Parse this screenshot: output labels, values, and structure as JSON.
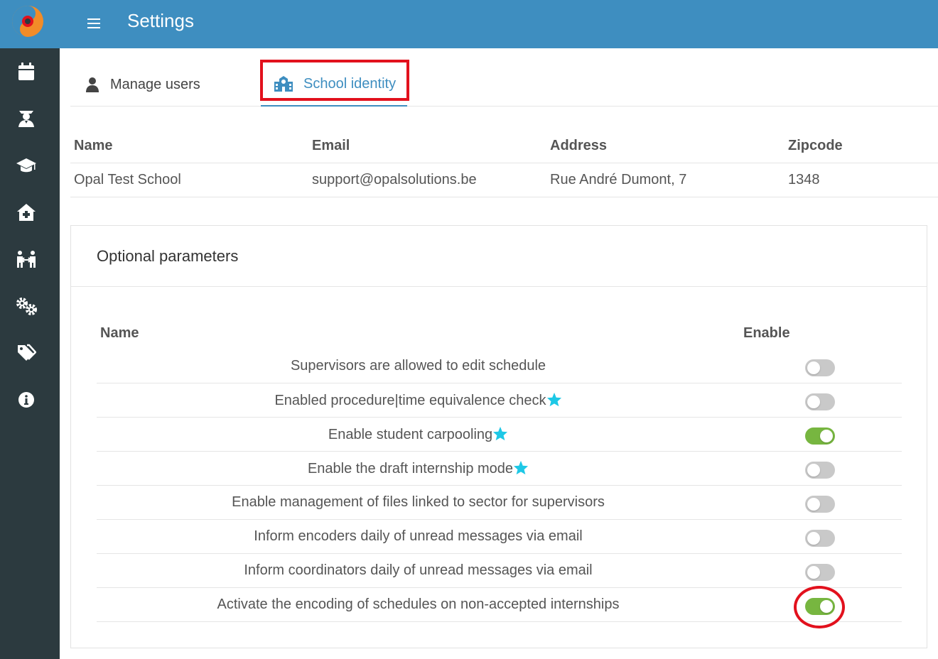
{
  "header": {
    "title": "Settings"
  },
  "sidebar": {
    "items": [
      {
        "icon": "calendar-icon"
      },
      {
        "icon": "graduate-user-icon"
      },
      {
        "icon": "graduation-cap-icon"
      },
      {
        "icon": "clinic-medical-icon"
      },
      {
        "icon": "people-arrows-icon"
      },
      {
        "icon": "cogs-icon"
      },
      {
        "icon": "tags-icon"
      },
      {
        "icon": "info-circle-icon"
      }
    ]
  },
  "tabs": {
    "manage_users": "Manage users",
    "school_identity": "School identity"
  },
  "identity_table": {
    "headers": [
      "Name",
      "Email",
      "Address",
      "Zipcode"
    ],
    "row": [
      "Opal Test School",
      "support@opalsolutions.be",
      "Rue André Dumont, 7",
      "1348"
    ]
  },
  "optional_parameters": {
    "title": "Optional parameters",
    "name_header": "Name",
    "enable_header": "Enable",
    "params": [
      {
        "label": "Supervisors are allowed to edit schedule",
        "star": false,
        "enabled": false
      },
      {
        "label": "Enabled procedure|time equivalence check",
        "star": true,
        "enabled": false
      },
      {
        "label": "Enable student carpooling",
        "star": true,
        "enabled": true
      },
      {
        "label": "Enable the draft internship mode",
        "star": true,
        "enabled": false
      },
      {
        "label": "Enable management of files linked to sector for supervisors",
        "star": false,
        "enabled": false
      },
      {
        "label": "Inform encoders daily of unread messages via email",
        "star": false,
        "enabled": false
      },
      {
        "label": "Inform coordinators daily of unread messages via email",
        "star": false,
        "enabled": false
      },
      {
        "label": "Activate the encoding of schedules on non-accepted internships",
        "star": false,
        "enabled": true
      }
    ]
  },
  "colors": {
    "brand_blue": "#3e8ec0",
    "sidebar_dark": "#2c3a3f",
    "toggle_on": "#77b640",
    "toggle_off": "#c9c9c9",
    "star_cyan": "#1ec8e6",
    "annotation_red": "#e2111d"
  }
}
